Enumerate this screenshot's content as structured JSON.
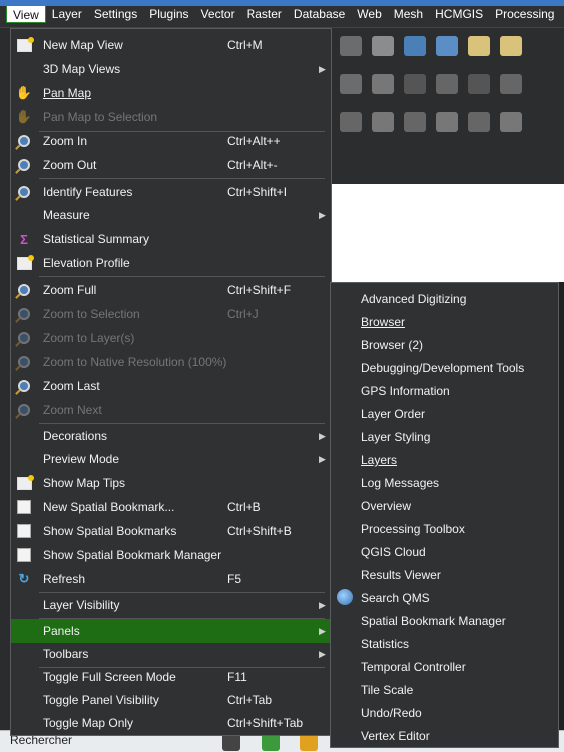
{
  "menubar": {
    "items": [
      "View",
      "Layer",
      "Settings",
      "Plugins",
      "Vector",
      "Raster",
      "Database",
      "Web",
      "Mesh",
      "HCMGIS",
      "Processing"
    ],
    "active": "View"
  },
  "view_menu": {
    "items": [
      {
        "label": "New Map View",
        "shortcut": "Ctrl+M",
        "icon": "new-map-view-icon"
      },
      {
        "label": "3D Map Views",
        "submenu": true
      },
      {
        "label": "Pan Map",
        "icon": "hand-pan-icon"
      },
      {
        "label": "Pan Map to Selection",
        "disabled": true,
        "icon": "pan-selection-icon"
      },
      {
        "label": "Zoom In",
        "shortcut": "Ctrl+Alt++",
        "icon": "zoom-in-icon"
      },
      {
        "label": "Zoom Out",
        "shortcut": "Ctrl+Alt+-",
        "icon": "zoom-out-icon"
      },
      {
        "label": "Identify Features",
        "shortcut": "Ctrl+Shift+I",
        "icon": "identify-icon"
      },
      {
        "label": "Measure",
        "submenu": true
      },
      {
        "label": "Statistical Summary",
        "icon": "sigma-icon"
      },
      {
        "label": "Elevation Profile",
        "icon": "elevation-profile-icon"
      },
      {
        "label": "Zoom Full",
        "shortcut": "Ctrl+Shift+F",
        "icon": "zoom-full-icon"
      },
      {
        "label": "Zoom to Selection",
        "shortcut": "Ctrl+J",
        "disabled": true,
        "icon": "zoom-selection-icon"
      },
      {
        "label": "Zoom to Layer(s)",
        "disabled": true,
        "icon": "zoom-layer-icon"
      },
      {
        "label": "Zoom to Native Resolution (100%)",
        "disabled": true,
        "icon": "zoom-native-icon"
      },
      {
        "label": "Zoom Last",
        "icon": "zoom-last-icon"
      },
      {
        "label": "Zoom Next",
        "disabled": true,
        "icon": "zoom-next-icon"
      },
      {
        "label": "Decorations",
        "submenu": true
      },
      {
        "label": "Preview Mode",
        "submenu": true
      },
      {
        "label": "Show Map Tips",
        "icon": "map-tips-icon"
      },
      {
        "label": "New Spatial Bookmark...",
        "shortcut": "Ctrl+B",
        "icon": "new-bookmark-icon"
      },
      {
        "label": "Show Spatial Bookmarks",
        "shortcut": "Ctrl+Shift+B",
        "icon": "bookmarks-icon"
      },
      {
        "label": "Show Spatial Bookmark Manager",
        "icon": "bookmark-manager-icon"
      },
      {
        "label": "Refresh",
        "shortcut": "F5",
        "icon": "refresh-icon"
      },
      {
        "label": "Layer Visibility",
        "submenu": true
      },
      {
        "label": "Panels",
        "submenu": true,
        "active": true
      },
      {
        "label": "Toolbars",
        "submenu": true
      },
      {
        "label": "Toggle Full Screen Mode",
        "shortcut": "F11"
      },
      {
        "label": "Toggle Panel Visibility",
        "shortcut": "Ctrl+Tab"
      },
      {
        "label": "Toggle Map Only",
        "shortcut": "Ctrl+Shift+Tab"
      }
    ]
  },
  "panels_submenu": {
    "items": [
      "Advanced Digitizing",
      "Browser",
      "Browser (2)",
      "Debugging/Development Tools",
      "GPS Information",
      "Layer Order",
      "Layer Styling",
      "Layers",
      "Log Messages",
      "Overview",
      "Processing Toolbox",
      "QGIS Cloud",
      "Results Viewer",
      "Search QMS",
      "Spatial Bookmark Manager",
      "Statistics",
      "Temporal Controller",
      "Tile Scale",
      "Undo/Redo",
      "Vertex Editor"
    ]
  },
  "taskbar": {
    "search_text": "Rechercher"
  },
  "colors": {
    "active_green": "#1e6c14",
    "menu_bg": "#2f3133",
    "disabled_text": "#767676"
  }
}
